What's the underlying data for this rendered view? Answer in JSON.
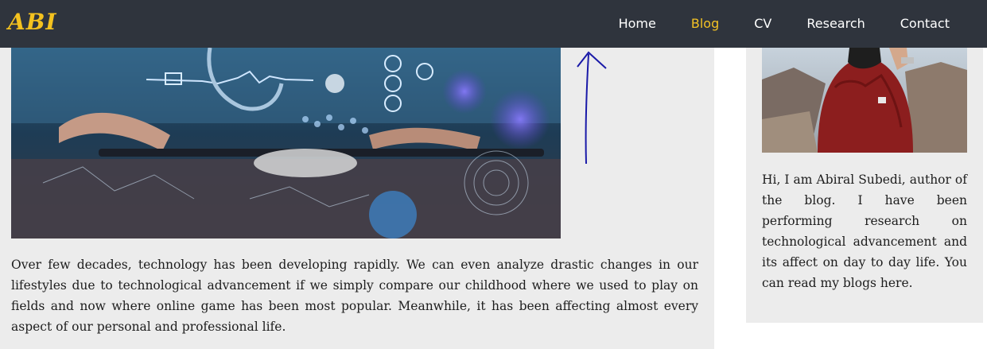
{
  "logo": {
    "text": "ABI"
  },
  "nav": {
    "items": [
      {
        "label": "Home",
        "active": false
      },
      {
        "label": "Blog",
        "active": true
      },
      {
        "label": "CV",
        "active": false
      },
      {
        "label": "Research",
        "active": false
      },
      {
        "label": "Contact",
        "active": false
      }
    ]
  },
  "hero": {
    "icon": "digital-health-image"
  },
  "annotation": {
    "icon": "up-arrow-annotation",
    "color": "#1a1aa8"
  },
  "article": {
    "paragraph": "Over few decades, technology has been developing rapidly. We can even analyze drastic changes in our lifestyles due to technological advancement if we simply compare our childhood where we used to play on fields and now where online game has been most popular. Meanwhile, it has been affecting almost every aspect of our personal and professional life."
  },
  "sidebar": {
    "photo_icon": "author-photo",
    "bio": "Hi, I am Abiral Subedi, author of the blog. I have been performing research on technological advancement and its affect on day to day life. You can read my blogs here."
  },
  "colors": {
    "navbar": "#2f343d",
    "accent": "#f2c125",
    "panel": "#ececec"
  }
}
